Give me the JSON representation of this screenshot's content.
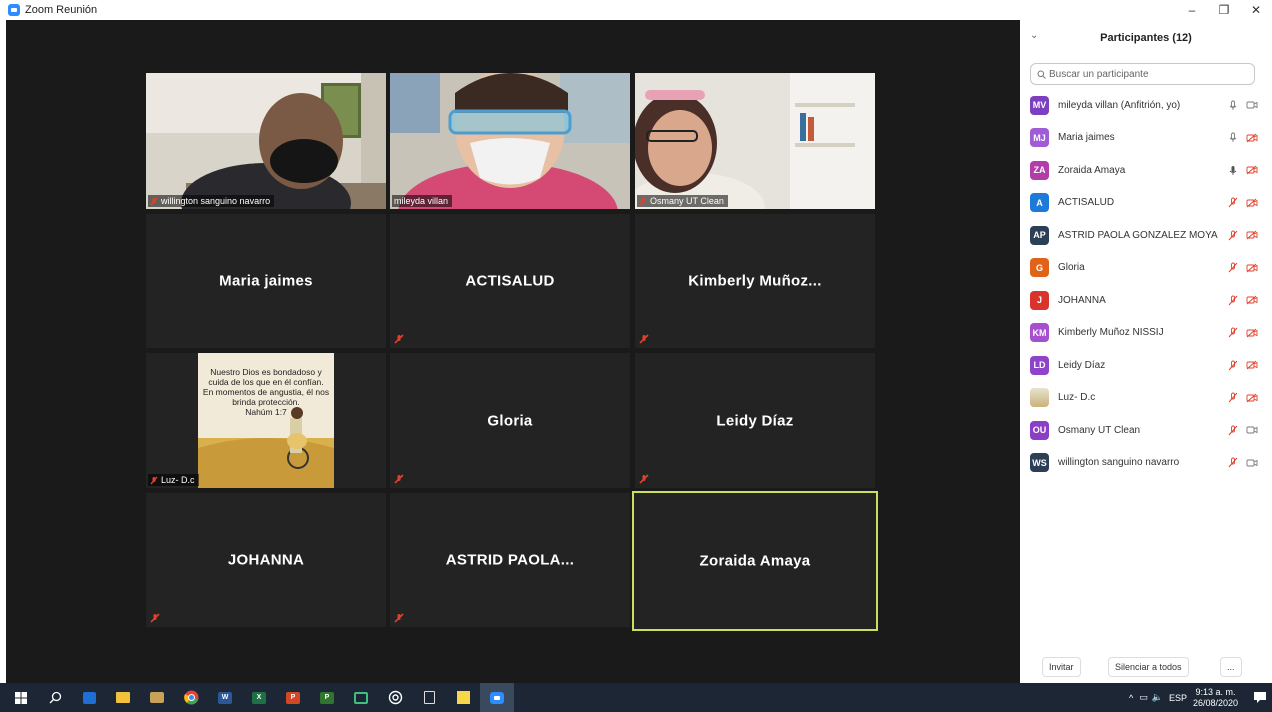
{
  "window": {
    "title": "Zoom Reunión",
    "minimize": "–",
    "restore": "❐",
    "close": "✕"
  },
  "tiles": [
    {
      "name": "willington sanguino navarro",
      "video": true,
      "muted": true
    },
    {
      "name": "mileyda villan",
      "video": true,
      "muted": false
    },
    {
      "name": "Osmany UT Clean",
      "video": true,
      "muted": true
    },
    {
      "name": "Maria jaimes",
      "video": false,
      "muted": false
    },
    {
      "name": "ACTISALUD",
      "video": false,
      "muted": true
    },
    {
      "name": "Kimberly  Muñoz...",
      "video": false,
      "muted": true
    },
    {
      "name": "Luz- D.c",
      "video": false,
      "muted": true
    },
    {
      "name": "Gloria",
      "video": false,
      "muted": true
    },
    {
      "name": "Leidy Díaz",
      "video": false,
      "muted": true
    },
    {
      "name": "JOHANNA",
      "video": false,
      "muted": true
    },
    {
      "name": "ASTRID  PAOLA...",
      "video": false,
      "muted": true
    },
    {
      "name": "Zoraida Amaya",
      "video": false,
      "muted": false,
      "active": true
    }
  ],
  "luz_image_text": {
    "l1": "Nuestro Dios es bondadoso y",
    "l2": "cuida de los que en él confían.",
    "l3": "En momentos de angustia, él nos",
    "l4": "brinda protección.",
    "l5": "Nahúm 1:7"
  },
  "panel": {
    "title": "Participantes (12)",
    "search_placeholder": "Buscar un participante",
    "participants": [
      {
        "initials": "MV",
        "name": "mileyda villan (Anfitrión, yo)",
        "color": "#7b3fbf",
        "mic": "on",
        "cam": "on"
      },
      {
        "initials": "MJ",
        "name": "Maria jaimes",
        "color": "#a05bd6",
        "mic": "on",
        "cam": "off"
      },
      {
        "initials": "ZA",
        "name": "Zoraida Amaya",
        "color": "#b33da8",
        "mic": "speaking",
        "cam": "off"
      },
      {
        "initials": "A",
        "name": "ACTISALUD",
        "color": "#1e7ad9",
        "mic": "off",
        "cam": "off"
      },
      {
        "initials": "AP",
        "name": "ASTRID PAOLA GONZALEZ MOYA",
        "color": "#2d3e57",
        "mic": "off",
        "cam": "off"
      },
      {
        "initials": "G",
        "name": "Gloria",
        "color": "#e0631c",
        "mic": "off",
        "cam": "off"
      },
      {
        "initials": "J",
        "name": "JOHANNA",
        "color": "#d9342b",
        "mic": "off",
        "cam": "off"
      },
      {
        "initials": "KM",
        "name": "Kimberly Muñoz NISSIJ",
        "color": "#a64fcf",
        "mic": "off",
        "cam": "off"
      },
      {
        "initials": "LD",
        "name": "Leidy Díaz",
        "color": "#8e44c9",
        "mic": "off",
        "cam": "off"
      },
      {
        "initials": "",
        "name": "Luz- D.c",
        "color": "#c9b27a",
        "mic": "off",
        "cam": "off",
        "image": true
      },
      {
        "initials": "OU",
        "name": "Osmany UT Clean",
        "color": "#8b3fc6",
        "mic": "off",
        "cam": "on"
      },
      {
        "initials": "WS",
        "name": "willington sanguino navarro",
        "color": "#2d3e57",
        "mic": "off",
        "cam": "on"
      }
    ],
    "invite_label": "Invitar",
    "mute_all_label": "Silenciar a todos",
    "more_label": "..."
  },
  "taskbar": {
    "lang": "ESP",
    "time": "9:13 a. m.",
    "date": "26/08/2020",
    "apps": [
      "windows-start",
      "search",
      "media-player",
      "file-explorer",
      "photos",
      "chrome",
      "word",
      "excel",
      "powerpoint",
      "project",
      "screen-app",
      "camera-app",
      "calculator",
      "sticky-notes",
      "zoom"
    ]
  },
  "colors": {
    "gallery_bg": "#1a1a1a",
    "tile_bg": "#232323",
    "active_border": "#c9e05c",
    "mute_red": "#e0412b",
    "taskbar": "#1c2634"
  }
}
